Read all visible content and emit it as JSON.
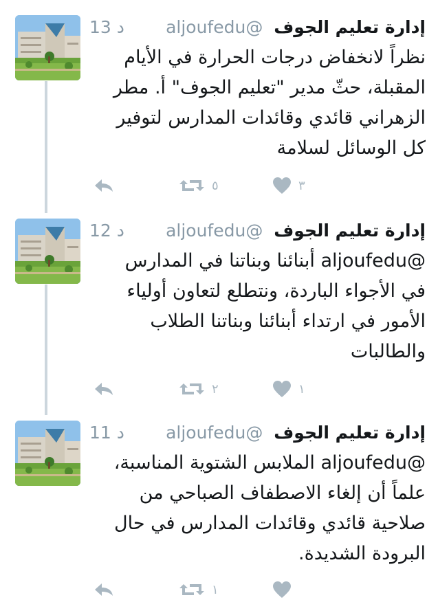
{
  "tweets": [
    {
      "author_name": "إدارة تعليم الجوف",
      "handle": "@aljoufedu",
      "time": "13 د",
      "text": "نظراً لانخفاض درجات الحرارة في الأيام\nالمقبلة، حثّ مدير \"تعليم الجوف\" أ. مطر\nالزهراني قائدي وقائدات المدارس لتوفير\nكل الوسائل لسلامة",
      "retweets": "٥",
      "likes": "٣"
    },
    {
      "author_name": "إدارة تعليم الجوف",
      "handle": "@aljoufedu",
      "time": "12 د",
      "text": "@aljoufedu أبنائنا وبناتنا في المدارس\nفي الأجواء الباردة، ونتطلع لتعاون أولياء\nالأمور في ارتداء أبنائنا وبناتنا الطلاب\nوالطالبات",
      "retweets": "٢",
      "likes": "١"
    },
    {
      "author_name": "إدارة تعليم الجوف",
      "handle": "@aljoufedu",
      "time": "11 د",
      "text": "@aljoufedu الملابس الشتوية المناسبة،\nعلماً أن إلغاء الاصطفاف الصباحي من\nصلاحية قائدي وقائدات المدارس في حال\nالبرودة الشديدة.",
      "retweets": "١",
      "likes": ""
    }
  ],
  "icons": {
    "reply": "reply-icon",
    "retweet": "retweet-icon",
    "like": "heart-icon"
  },
  "colors": {
    "muted": "#8899a6",
    "icon": "#aab8c2",
    "thread": "#ccd6dd"
  }
}
